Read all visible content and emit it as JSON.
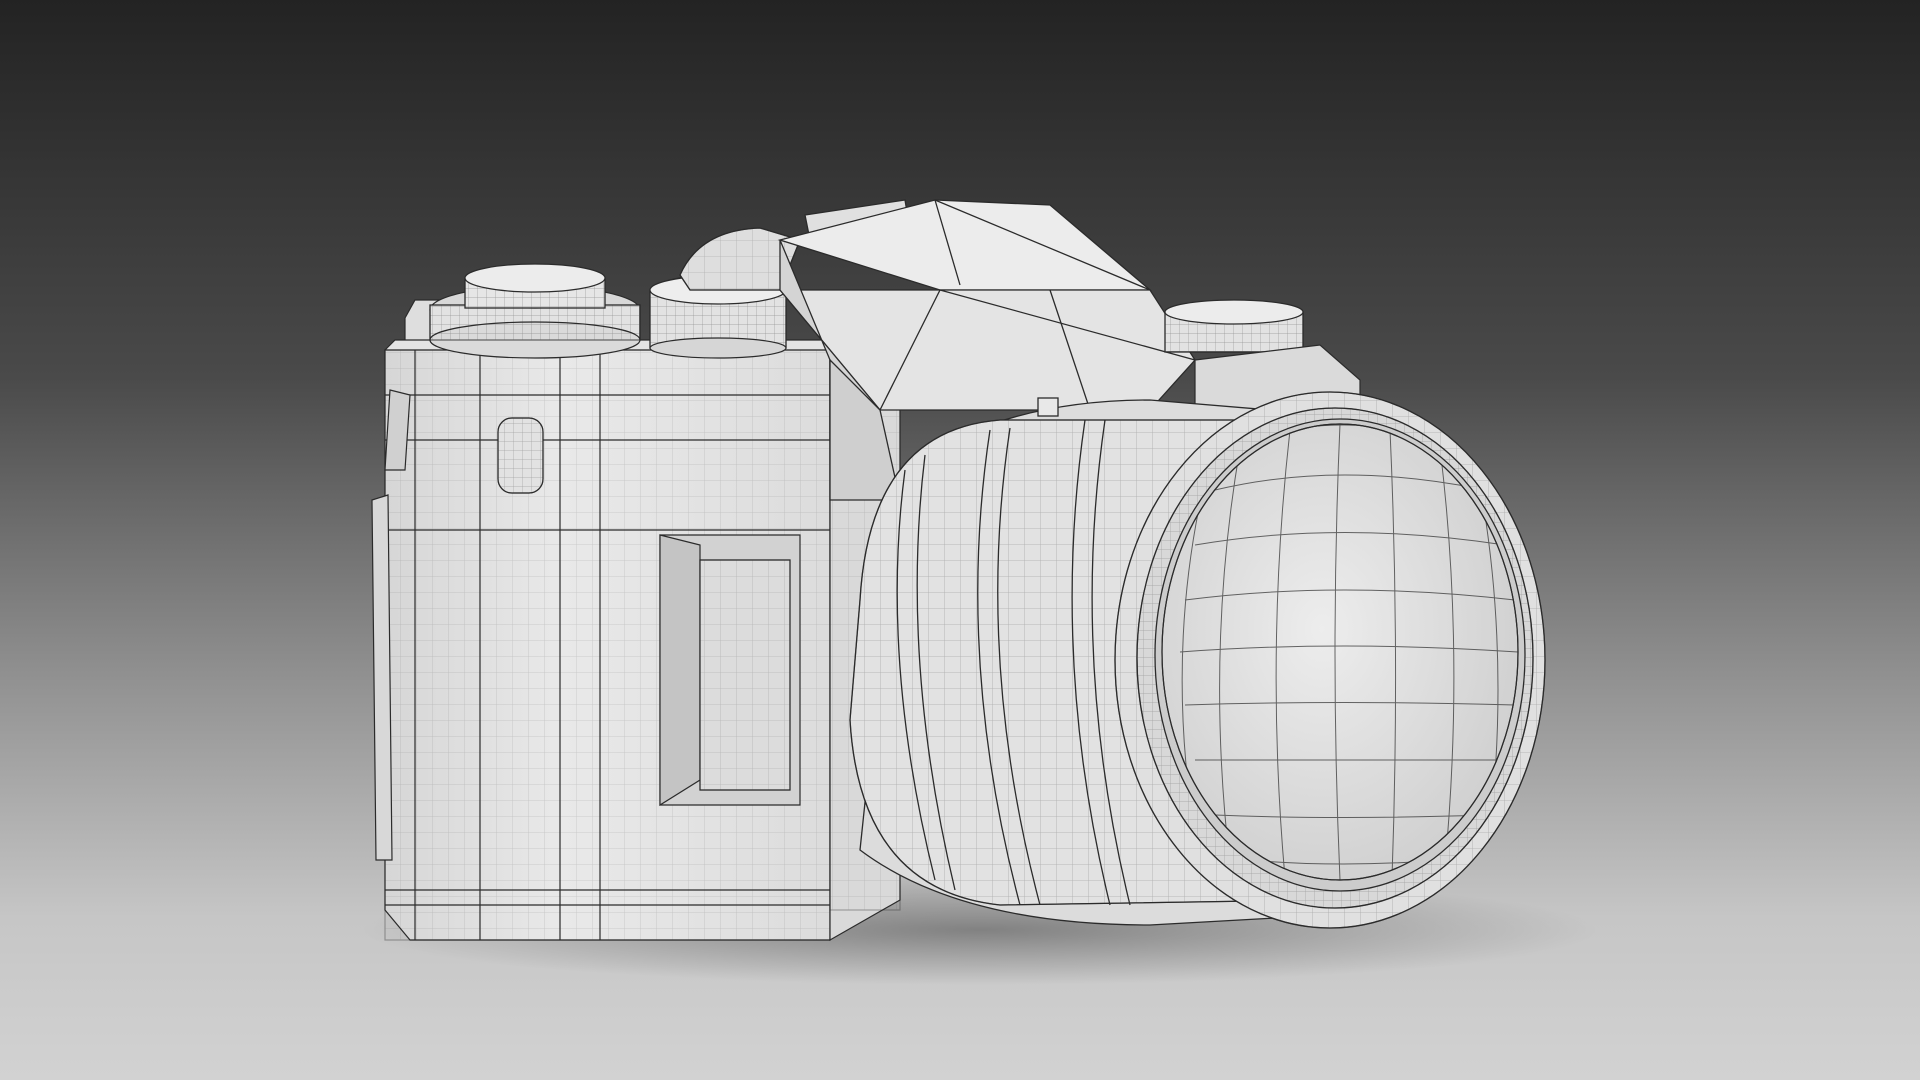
{
  "scene": {
    "subject": "camera-wireframe",
    "colors": {
      "background_top": "#262626",
      "background_mid": "#5e5e5e",
      "background_bottom": "#c9c9c9",
      "model_fill": "#e6e6e6",
      "model_shade": "#c9c9c9",
      "wire": "#2b2b2b"
    }
  }
}
